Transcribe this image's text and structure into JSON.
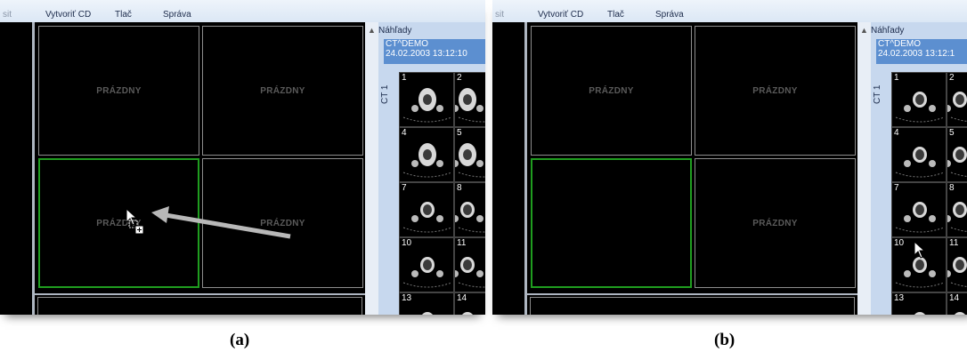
{
  "menu": {
    "partial": "sit",
    "burn_cd": "Vytvoriť CD",
    "print": "Tlač",
    "manage": "Správa"
  },
  "viewer": {
    "empty_label": "PRÁZDNY"
  },
  "thumbnails": {
    "header": "Náhľady",
    "study_name": "CT^DEMO",
    "study_date": "24.02.2003 13:12:10",
    "study_date_b": "24.02.2003 13:12:1",
    "series_label": "CT 1",
    "numbers": [
      "1",
      "2",
      "4",
      "5",
      "7",
      "8",
      "10",
      "11",
      "13",
      "14"
    ]
  },
  "captions": {
    "a": "(a)",
    "b": "(b)"
  },
  "colors": {
    "selection_border": "#1f9d1f",
    "study_header": "#5c8fd0",
    "panel_bg": "#c7d8ee"
  },
  "icons": {
    "scroll_up": "▲"
  }
}
